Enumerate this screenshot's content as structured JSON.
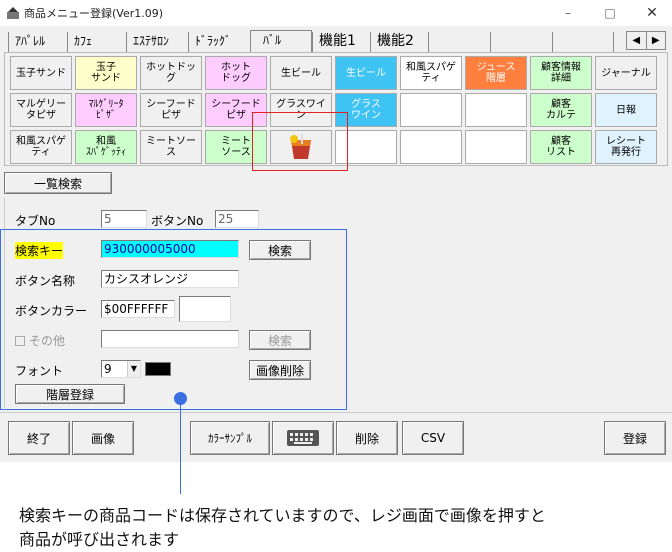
{
  "window": {
    "title": "商品メニュー登録(Ver1.09)",
    "controls": [
      "–",
      "□",
      "✕"
    ]
  },
  "tabs": [
    {
      "label": "ｱﾊﾟﾚﾙ",
      "selected": false
    },
    {
      "label": "ｶﾌｪ",
      "selected": false
    },
    {
      "label": "ｴｽﾃｻﾛﾝ",
      "selected": false
    },
    {
      "label": "ﾄﾞﾗｯｸﾞ",
      "selected": false
    },
    {
      "label": "ﾊﾞﾙ",
      "selected": true
    },
    {
      "label": "機能1",
      "selected": false
    },
    {
      "label": "機能2",
      "selected": false
    }
  ],
  "tab_scroll": {
    "left": "◀",
    "right": "▶"
  },
  "grid": [
    [
      {
        "label": "玉子サンド",
        "bg": "#f0f0f0",
        "fg": "#000"
      },
      {
        "label": "玉子\nサンド",
        "bg": "#ffffcc",
        "fg": "#000"
      },
      {
        "label": "ホットドッ\nグ",
        "bg": "#f0f0f0",
        "fg": "#000"
      },
      {
        "label": "ホット\nドッグ",
        "bg": "#ffccff",
        "fg": "#000"
      },
      {
        "label": "生ビール",
        "bg": "#f0f0f0",
        "fg": "#000"
      },
      {
        "label": "生ビール",
        "bg": "#3fc3f3",
        "fg": "#ffffff"
      },
      {
        "label": "和風スパゲ\nティ",
        "bg": "#ffffff",
        "fg": "#000"
      },
      {
        "label": "ジュース\n階層",
        "bg": "#ff7f3f",
        "fg": "#ffffff"
      },
      {
        "label": "顧客情報\n詳細",
        "bg": "#ccffcc",
        "fg": "#000"
      },
      {
        "label": "ジャーナル",
        "bg": "#f0f0f0",
        "fg": "#000"
      }
    ],
    [
      {
        "label": "マルゲリー\nタピザ",
        "bg": "#f0f0f0",
        "fg": "#000"
      },
      {
        "label": "ﾏﾙｹﾞﾘｰﾀ\nﾋﾟｻﾞ",
        "bg": "#ffccff",
        "fg": "#000"
      },
      {
        "label": "シーフード\nピザ",
        "bg": "#f0f0f0",
        "fg": "#000"
      },
      {
        "label": "シーフード\nピザ",
        "bg": "#ffccff",
        "fg": "#000"
      },
      {
        "label": "グラスワイ\nン",
        "bg": "#f0f0f0",
        "fg": "#000"
      },
      {
        "label": "グラス\nワイン",
        "bg": "#3fc3f3",
        "fg": "#ffffff"
      },
      {
        "label": "",
        "bg": "#ffffff",
        "fg": "#000"
      },
      {
        "label": "",
        "bg": "#ffffff",
        "fg": "#000"
      },
      {
        "label": "顧客\nカルテ",
        "bg": "#ccffcc",
        "fg": "#000"
      },
      {
        "label": "日報",
        "bg": "#dff3ff",
        "fg": "#000"
      }
    ],
    [
      {
        "label": "和風スパゲ\nティ",
        "bg": "#f0f0f0",
        "fg": "#000"
      },
      {
        "label": "和風\nｽﾊﾟｹﾞｯﾃｨ",
        "bg": "#ccffcc",
        "fg": "#000"
      },
      {
        "label": "ミートソー\nス",
        "bg": "#f0f0f0",
        "fg": "#000"
      },
      {
        "label": "ミート\nソース",
        "bg": "#ccffcc",
        "fg": "#000"
      },
      {
        "label": "",
        "bg": "#f0f0f0",
        "fg": "#000",
        "image": true
      },
      {
        "label": "",
        "bg": "#ffffff",
        "fg": "#000"
      },
      {
        "label": "",
        "bg": "#ffffff",
        "fg": "#000"
      },
      {
        "label": "",
        "bg": "#ffffff",
        "fg": "#000"
      },
      {
        "label": "顧客\nリスト",
        "bg": "#ccffcc",
        "fg": "#000"
      },
      {
        "label": "レシート\n再発行",
        "bg": "#dff3ff",
        "fg": "#000"
      }
    ]
  ],
  "list_search_button": "一覧検索",
  "form": {
    "tab_no_label": "タブNo",
    "tab_no_value": "5",
    "button_no_label": "ボタンNo",
    "button_no_value": "25",
    "search_key_label": "検索キー",
    "search_key_value": "930000005000",
    "search_button": "検索",
    "button_name_label": "ボタン名称",
    "button_name_value": "カシスオレンジ",
    "button_color_label": "ボタンカラー",
    "button_color_value": "$00FFFFFF",
    "other_label": "その他",
    "other_value": "",
    "other_search_button": "検索",
    "font_label": "フォント",
    "font_size_value": "9",
    "font_color": "#000000",
    "delete_image_button": "画像削除",
    "register_layer_button": "階層登録"
  },
  "footer": {
    "end_button": "終了",
    "image_button": "画像",
    "color_sample_button": "ｶﾗｰｻﾝﾌﾟﾙ",
    "keyboard_icon": "keyboard-icon",
    "delete_button": "削除",
    "csv_button": "CSV",
    "register_button": "登録"
  },
  "caption": "検索キーの商品コードは保存されていますので、レジ画面で画像を押すと\n商品が呼び出されます",
  "colors": {
    "accent_blue": "#3b6fe0",
    "annotation_red": "#e02222",
    "search_key_highlight": "#ffff00",
    "search_value_bg": "#00ffff"
  }
}
